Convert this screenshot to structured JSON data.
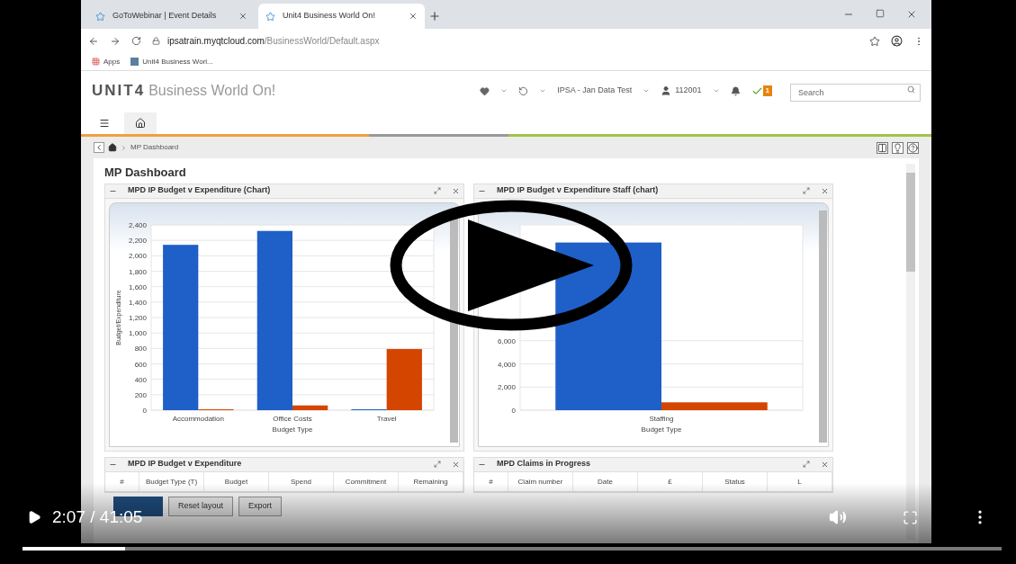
{
  "browser": {
    "tabs": [
      {
        "label": "GoToWebinar | Event Details",
        "selected": false
      },
      {
        "label": "Unit4 Business World On!",
        "selected": true
      }
    ],
    "url": {
      "host": "ipsatrain.myqtcloud.com",
      "path": "/BusinessWorld/Default.aspx"
    },
    "bookmarks": [
      "Apps",
      "Unit4 Business Worl..."
    ]
  },
  "app": {
    "logo": "UNIT4",
    "product": "Business World On!",
    "company": "IPSA - Jan Data Test",
    "user": "112001",
    "tasks_badge": "1",
    "search": {
      "placeholder": "Search"
    },
    "nav_tabs": [
      {
        "kind": "menu",
        "selected": false
      },
      {
        "kind": "home",
        "selected": true
      }
    ],
    "breadcrumb": "MP Dashboard",
    "page_title": "MP Dashboard",
    "chart_panels": [
      {
        "title": "MPD IP Budget v Expenditure (Chart)",
        "chart_data": {
          "type": "bar",
          "ylabel": "Budget/Expenditure",
          "xlabel": "Budget Type",
          "categories": [
            "Accommodation",
            "Office Costs",
            "Travel"
          ],
          "series": [
            {
              "color": "#1f5fc8",
              "values": [
                2130,
                2310,
                0
              ]
            },
            {
              "color": "#d44500",
              "values": [
                0,
                50,
                780
              ]
            }
          ],
          "grid": true,
          "ylim": [
            0,
            2400
          ],
          "yticks": [
            {
              "value": 0,
              "label": "0"
            },
            {
              "value": 200,
              "label": "200"
            },
            {
              "value": 400,
              "label": "400"
            },
            {
              "value": 600,
              "label": "600"
            },
            {
              "value": 800,
              "label": "800"
            },
            {
              "value": 1000,
              "label": "1,000"
            },
            {
              "value": 1200,
              "label": "1,200"
            },
            {
              "value": 1400,
              "label": "1,400"
            },
            {
              "value": 1600,
              "label": "1,600"
            },
            {
              "value": 1800,
              "label": "1,800"
            },
            {
              "value": 2000,
              "label": "2,000"
            },
            {
              "value": 2200,
              "label": "2,200"
            },
            {
              "value": 2400,
              "label": "2,400"
            }
          ]
        }
      },
      {
        "title": "MPD IP Budget v Expenditure Staff (chart)",
        "chart_data": {
          "type": "bar",
          "xlabel": "Budget Type",
          "categories": [
            "Staffing"
          ],
          "series": [
            {
              "color": "#1f5fc8",
              "values": [
                14400
              ]
            },
            {
              "color": "#d44500",
              "values": [
                600
              ]
            }
          ],
          "grid": true,
          "ylim": [
            0,
            16000
          ],
          "yticks": [
            {
              "value": 0,
              "label": "0"
            },
            {
              "value": 2000,
              "label": "2,000"
            },
            {
              "value": 4000,
              "label": "4,000"
            },
            {
              "value": 6000,
              "label": "6,000"
            }
          ]
        }
      }
    ],
    "table_panels": [
      {
        "title": "MPD IP Budget v Expenditure",
        "columns": [
          "#",
          "Budget Type (T)",
          "Budget",
          "Spend",
          "Commitment",
          "Remaining"
        ]
      },
      {
        "title": "MPD Claims in Progress",
        "columns": [
          "#",
          "Claim number",
          "Date",
          "£",
          "Status",
          "L"
        ]
      }
    ],
    "buttons": [
      "Reset layout",
      "Export"
    ]
  },
  "player": {
    "time": "2:07 / 41:05",
    "level": 0.105
  }
}
